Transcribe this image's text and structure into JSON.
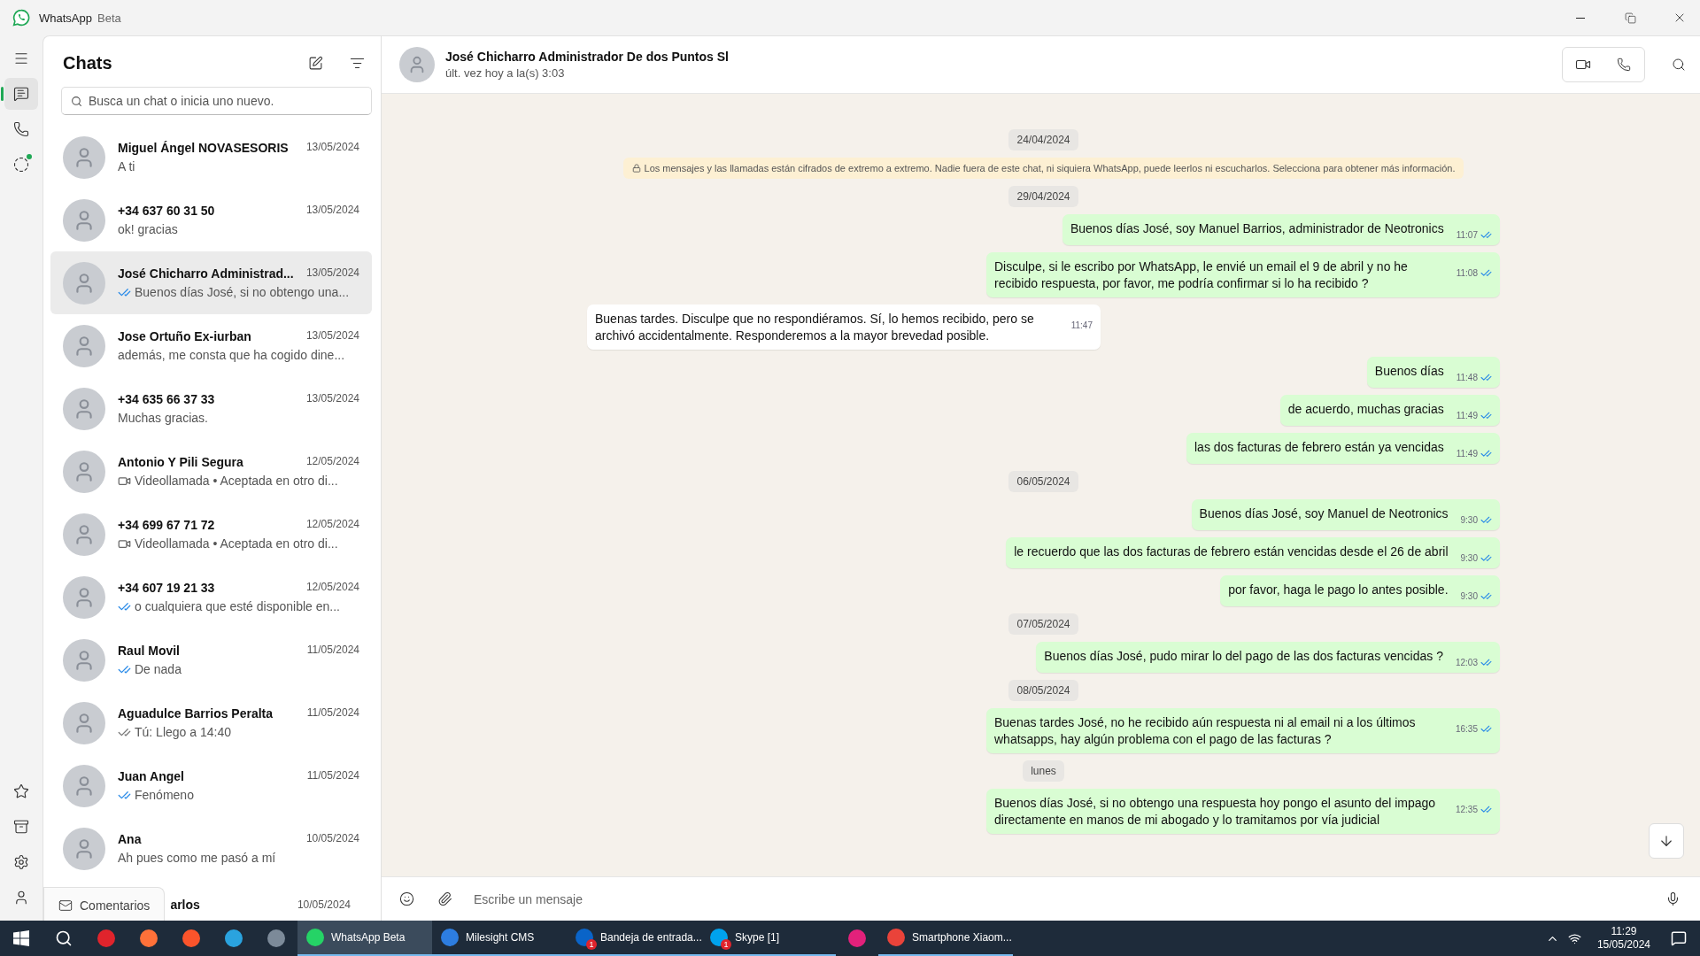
{
  "window": {
    "title": "WhatsApp",
    "subtitle": "Beta"
  },
  "nav": [
    {
      "kind": "chats",
      "selected": true,
      "unread": false
    },
    {
      "kind": "calls",
      "selected": false,
      "unread": false
    },
    {
      "kind": "status",
      "selected": false,
      "unread": true
    }
  ],
  "nav_bottom": [
    {
      "kind": "starred",
      "selected": false
    },
    {
      "kind": "archived",
      "selected": false
    },
    {
      "kind": "settings",
      "selected": false
    },
    {
      "kind": "profile",
      "selected": false
    }
  ],
  "chat_list": {
    "title": "Chats",
    "search": {
      "placeholder": "Busca un chat o inicia uno nuevo."
    },
    "items": [
      {
        "name": "Miguel Ángel NOVASESORIS",
        "date": "13/05/2024",
        "preview": "A ti",
        "kind": "plain",
        "selected": false
      },
      {
        "name": "+34 637 60 31 50",
        "date": "13/05/2024",
        "preview": "ok! gracias",
        "kind": "plain",
        "selected": false
      },
      {
        "name": "José Chicharro Administrad...",
        "date": "13/05/2024",
        "preview": "Buenos días José, si no obtengo una...",
        "kind": "read",
        "selected": true
      },
      {
        "name": "Jose Ortuño Ex-iurban",
        "date": "13/05/2024",
        "preview": "además, me consta que ha cogido dine...",
        "kind": "plain",
        "selected": false
      },
      {
        "name": "+34 635 66 37 33",
        "date": "13/05/2024",
        "preview": "Muchas gracias.",
        "kind": "plain",
        "selected": false
      },
      {
        "name": "Antonio Y Pili Segura",
        "date": "12/05/2024",
        "preview": "Videollamada • Aceptada en otro di...",
        "kind": "video",
        "selected": false
      },
      {
        "name": "+34 699 67 71 72",
        "date": "12/05/2024",
        "preview": "Videollamada • Aceptada en otro di...",
        "kind": "video",
        "selected": false
      },
      {
        "name": "+34 607 19 21 33",
        "date": "12/05/2024",
        "preview": "o cualquiera que esté disponible en...",
        "kind": "read",
        "selected": false
      },
      {
        "name": "Raul Movil",
        "date": "11/05/2024",
        "preview": "De nada",
        "kind": "read",
        "selected": false
      },
      {
        "name": "Aguadulce Barrios Peralta",
        "date": "11/05/2024",
        "preview": "Tú: Llego a 14:40",
        "kind": "delivered",
        "selected": false
      },
      {
        "name": "Juan Angel",
        "date": "11/05/2024",
        "preview": "Fenómeno",
        "kind": "read",
        "selected": false
      },
      {
        "name": "Ana",
        "date": "10/05/2024",
        "preview": "Ah pues como me pasó a mí",
        "kind": "plain",
        "selected": false
      },
      {
        "name": "arlos",
        "date": "10/05/2024",
        "selected": false
      }
    ],
    "feedback": "Comentarios"
  },
  "chat": {
    "name": "José Chicharro Administrador De dos Puntos Sl",
    "last_seen": "últ. vez hoy a la(s) 3:03",
    "messages": [
      {
        "kind": "date",
        "text": "24/04/2024"
      },
      {
        "kind": "notice",
        "text": "Los mensajes y las llamadas están cifrados de extremo a extremo. Nadie fuera de este chat, ni siquiera WhatsApp, puede leerlos ni escucharlos. Selecciona para obtener más información."
      },
      {
        "kind": "date",
        "text": "29/04/2024"
      },
      {
        "kind": "out",
        "text": "Buenos días José, soy Manuel Barrios, administrador de Neotronics",
        "time": "11:07",
        "read": true
      },
      {
        "kind": "out",
        "text": "Disculpe, si le escribo por WhatsApp, le envié un email el 9 de abril y no he recibido respuesta, por favor, me podría confirmar si lo ha recibido ?",
        "time": "11:08",
        "read": true
      },
      {
        "kind": "in",
        "text": "Buenas tardes. Disculpe que no respondiéramos. Sí, lo hemos recibido, pero se archivó accidentalmente. Responderemos a la mayor brevedad posible.",
        "time": "11:47"
      },
      {
        "kind": "out",
        "text": "Buenos días",
        "time": "11:48",
        "read": true
      },
      {
        "kind": "out",
        "text": "de acuerdo, muchas gracias",
        "time": "11:49",
        "read": true
      },
      {
        "kind": "out",
        "text": "las dos facturas de febrero están ya vencidas",
        "time": "11:49",
        "read": true
      },
      {
        "kind": "date",
        "text": "06/05/2024"
      },
      {
        "kind": "out",
        "text": "Buenos días José, soy Manuel de Neotronics",
        "time": "9:30",
        "read": true
      },
      {
        "kind": "out",
        "text": "le recuerdo que las dos facturas de febrero están vencidas desde el 26 de abril",
        "time": "9:30",
        "read": true
      },
      {
        "kind": "out",
        "text": "por favor, haga le pago lo antes posible.",
        "time": "9:30",
        "read": true
      },
      {
        "kind": "date",
        "text": "07/05/2024"
      },
      {
        "kind": "out",
        "text": "Buenos días José, pudo mirar lo del pago de las dos facturas vencidas ?",
        "time": "12:03",
        "read": true
      },
      {
        "kind": "date",
        "text": "08/05/2024"
      },
      {
        "kind": "out",
        "text": "Buenas tardes José, no he recibido aún respuesta ni al email ni a los últimos whatsapps, hay algún problema con el pago de las facturas ?",
        "time": "16:35",
        "read": true
      },
      {
        "kind": "date",
        "text": "lunes"
      },
      {
        "kind": "out",
        "text": "Buenos días José, si no obtengo una respuesta hoy pongo el asunto del impago directamente en manos de mi abogado y lo tramitamos por vía judicial",
        "time": "12:35",
        "read": true
      }
    ],
    "composer": {
      "placeholder": "Escribe un mensaje"
    }
  },
  "taskbar": {
    "windows": [
      {
        "label": "WhatsApp Beta",
        "selected": true
      },
      {
        "label": "Milesight CMS",
        "selected": false
      },
      {
        "label": "Bandeja de entrada...",
        "selected": false,
        "badge": "1"
      },
      {
        "label": "Skype [1]",
        "selected": false,
        "badge": "1"
      },
      {
        "label": "Smartphone Xiaom...",
        "selected": false
      }
    ],
    "time": "11:29",
    "date": "15/05/2024"
  }
}
